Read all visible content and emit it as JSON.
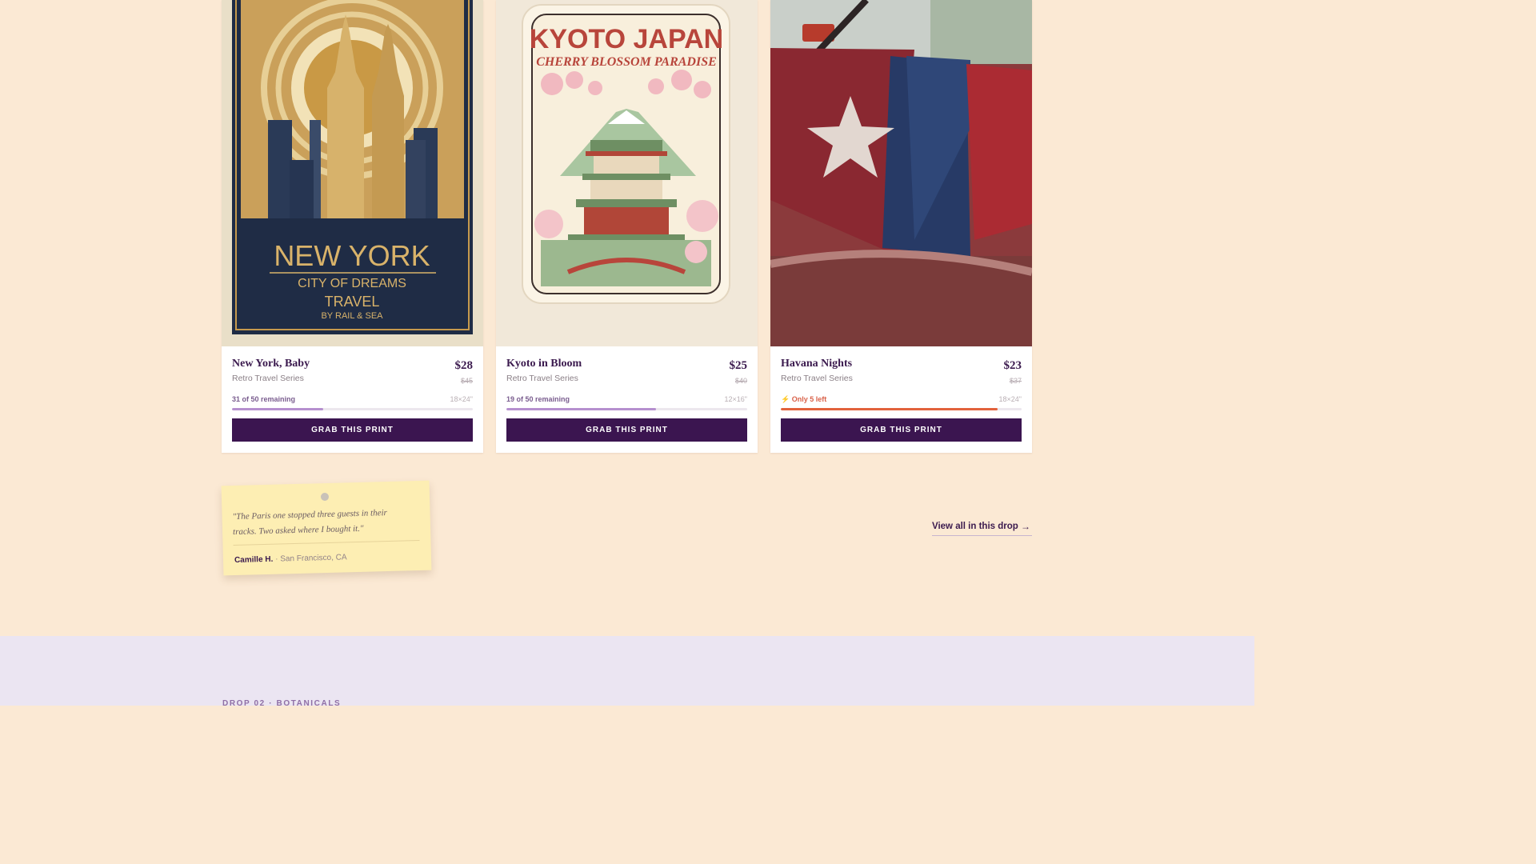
{
  "products": [
    {
      "title": "New York, Baby",
      "series": "Retro Travel Series",
      "price": "$28",
      "old_price": "$45",
      "stock_text": "31 of 50 remaining",
      "stock_fraction": 0.38,
      "size": "18×24\"",
      "button_label": "GRAB THIS PRINT",
      "image": {
        "name": "new-york-poster-image",
        "title": "NEW YORK",
        "subtitle": "CITY OF DREAMS",
        "line3": "TRAVEL",
        "line4": "BY RAIL & SEA"
      }
    },
    {
      "title": "Kyoto in Bloom",
      "series": "Retro Travel Series",
      "price": "$25",
      "old_price": "$40",
      "stock_text": "19 of 50 remaining",
      "stock_fraction": 0.62,
      "size": "12×16\"",
      "button_label": "GRAB THIS PRINT",
      "image": {
        "name": "kyoto-poster-image",
        "title": "KYOTO JAPAN",
        "subtitle": "CHERRY BLOSSOM PARADISE"
      }
    },
    {
      "title": "Havana Nights",
      "series": "Retro Travel Series",
      "price": "$23",
      "old_price": "$37",
      "stock_text": "⚡ Only 5 left",
      "stock_fraction": 0.9,
      "stock_urgent": true,
      "size": "18×24\"",
      "button_label": "GRAB THIS PRINT",
      "image": {
        "name": "havana-flag-photo"
      }
    }
  ],
  "testimonial": {
    "quote": "\"The Paris one stopped three guests in their tracks. Two asked where I bought it.\"",
    "author": "Camille H.",
    "location": " · San Francisco, CA"
  },
  "view_all": {
    "label": "View all in this drop",
    "icon": "arrow-right-icon"
  },
  "next_section": {
    "eyebrow": "DROP 02 · BOTANICALS"
  },
  "colors": {
    "page_background": "#fbe9d4",
    "accent_button": "#3b1550",
    "progress_normal": "#b690cf",
    "progress_urgent": "#e2623c",
    "lower_band": "#ebe5f2",
    "note_background": "#fdeeb3"
  }
}
